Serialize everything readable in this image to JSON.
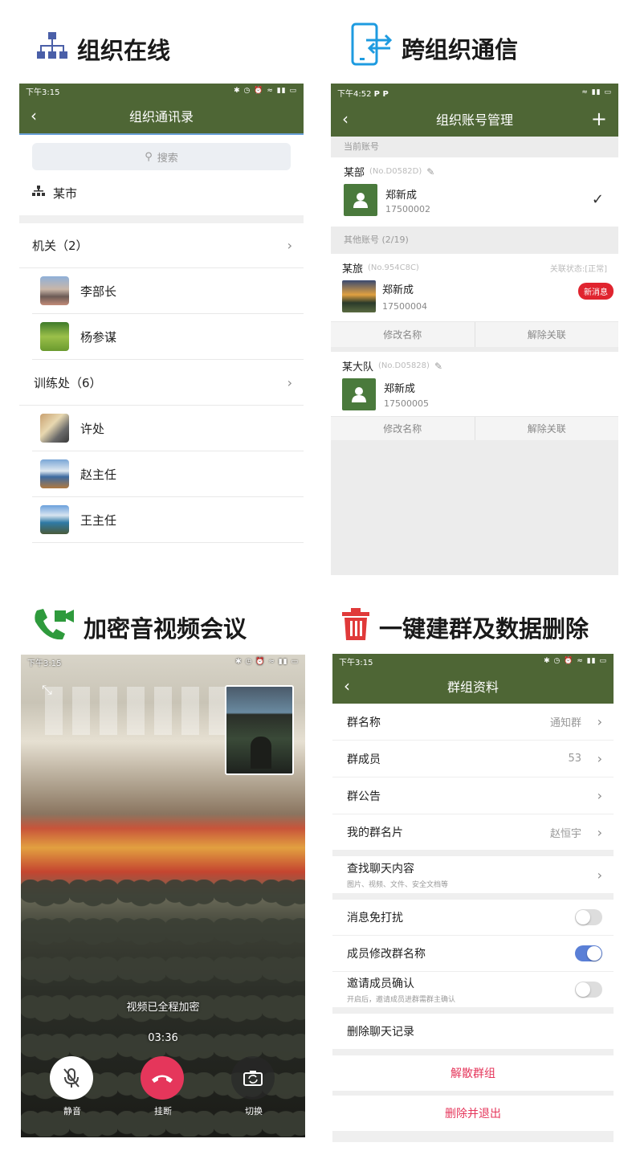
{
  "sections": {
    "s1_title": "组织在线",
    "s2_title": "跨组织通信",
    "s3_title": "加密音视频会议",
    "s4_title": "一键建群及数据删除"
  },
  "p1": {
    "status_time": "下午3:15",
    "title": "组织通讯录",
    "search_placeholder": "搜索",
    "org_name": "某市",
    "groups": [
      {
        "label": "机关（2）",
        "members": [
          "李部长",
          "杨参谋"
        ]
      },
      {
        "label": "训练处（6）",
        "members": [
          "许处",
          "赵主任",
          "王主任"
        ]
      }
    ]
  },
  "p2": {
    "status_time": "下午4:52",
    "status_letters": "P  P",
    "title": "组织账号管理",
    "current_header": "当前账号",
    "current": {
      "org": "某部",
      "no": "(No.D0582D)",
      "name": "郑新成",
      "phone": "17500002"
    },
    "other_header": "其他账号 (2/19)",
    "others": [
      {
        "org": "某旅",
        "no": "(No.954C8C)",
        "status": "关联状态:[正常]",
        "badge": "新消息",
        "name": "郑新成",
        "phone": "17500004",
        "action1": "修改名称",
        "action2": "解除关联"
      },
      {
        "org": "某大队",
        "no": "(No.D05828)",
        "name": "郑新成",
        "phone": "17500005",
        "action1": "修改名称",
        "action2": "解除关联"
      }
    ]
  },
  "p3": {
    "status_time": "下午3:15",
    "encrypt_text": "视频已全程加密",
    "timer": "03:36",
    "mute_label": "静音",
    "hangup_label": "挂断",
    "switch_label": "切换"
  },
  "p4": {
    "status_time": "下午3:15",
    "title": "群组资料",
    "group_name_label": "群名称",
    "group_name_value": "通知群",
    "members_label": "群成员",
    "members_value": "53",
    "notice_label": "群公告",
    "card_label": "我的群名片",
    "card_value": "赵恒宇",
    "search_label": "查找聊天内容",
    "search_sub": "图片、视频、文件、安全文档等",
    "dnd_label": "消息免打扰",
    "dnd_on": false,
    "rename_label": "成员修改群名称",
    "rename_on": true,
    "invite_label": "邀请成员确认",
    "invite_sub": "开启后，邀请成员进群需群主确认",
    "invite_on": false,
    "clear_label": "删除聊天记录",
    "dissolve_label": "解散群组",
    "exit_label": "删除并退出"
  },
  "colors": {
    "brand_green": "#4e6635",
    "danger": "#e5365b",
    "toggle_on": "#5a7fd6",
    "badge_red": "#e0242f"
  }
}
